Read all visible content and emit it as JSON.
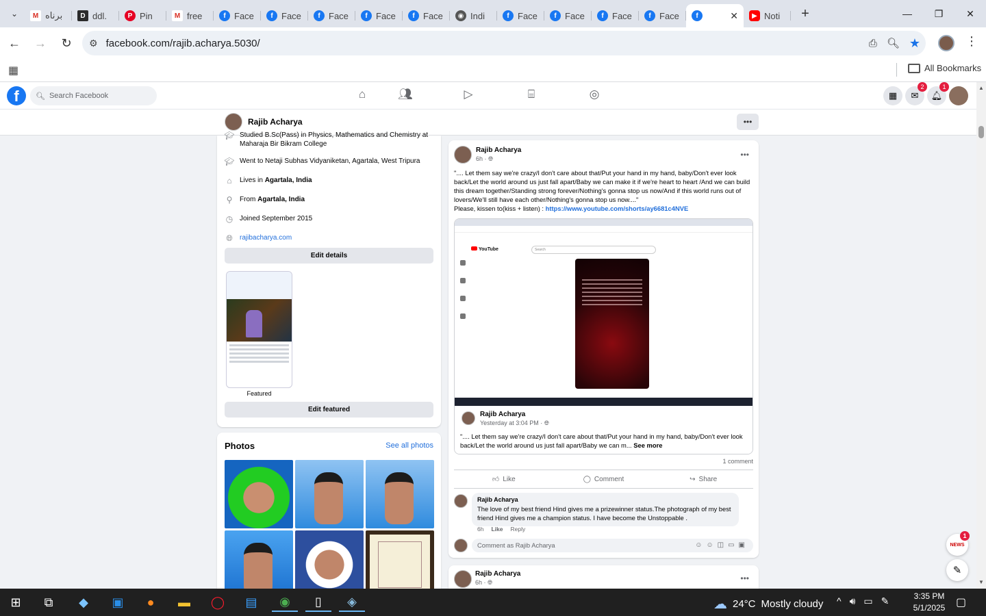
{
  "browser": {
    "tabs": [
      {
        "icon": "gmail-icon",
        "title": "برناه",
        "fav": "gm",
        "letter": "M"
      },
      {
        "icon": "document-icon",
        "title": "ddl.",
        "fav": "dd",
        "letter": "D"
      },
      {
        "icon": "pinterest-icon",
        "title": "Pin",
        "fav": "pin",
        "letter": "P"
      },
      {
        "icon": "gmail-icon",
        "title": "free",
        "fav": "gm",
        "letter": "M"
      },
      {
        "icon": "facebook-icon",
        "title": "Face",
        "fav": "fb",
        "letter": "f"
      },
      {
        "icon": "facebook-icon",
        "title": "Face",
        "fav": "fb",
        "letter": "f"
      },
      {
        "icon": "facebook-icon",
        "title": "Face",
        "fav": "fb",
        "letter": "f"
      },
      {
        "icon": "facebook-icon",
        "title": "Face",
        "fav": "fb",
        "letter": "f"
      },
      {
        "icon": "facebook-icon",
        "title": "Face",
        "fav": "fb",
        "letter": "f"
      },
      {
        "icon": "globe-icon",
        "title": "Indi",
        "fav": "gl",
        "letter": "◉"
      },
      {
        "icon": "facebook-icon",
        "title": "Face",
        "fav": "fb",
        "letter": "f"
      },
      {
        "icon": "facebook-icon",
        "title": "Face",
        "fav": "fb",
        "letter": "f"
      },
      {
        "icon": "facebook-icon",
        "title": "Face",
        "fav": "fb",
        "letter": "f"
      },
      {
        "icon": "facebook-icon",
        "title": "Face",
        "fav": "fb",
        "letter": "f"
      }
    ],
    "active_tab": {
      "icon": "facebook-icon",
      "close": "✕"
    },
    "after_tab": {
      "icon": "youtube-icon",
      "title": "Noti"
    },
    "new_tab": "+",
    "url": "facebook.com/rajib.acharya.5030/",
    "all_bookmarks": "All Bookmarks"
  },
  "facebook": {
    "search_placeholder": "Search Facebook",
    "messenger_badge": "2",
    "notifications_badge": "1"
  },
  "profile": {
    "name": "Rajib Acharya"
  },
  "intro": {
    "studied_prefix": "Studied B.Sc(Pass) in Physics, Mathematics and Chemistry at",
    "studied_school": "Maharaja Bir Bikram College",
    "went_to": "Went to Netaji Subhas Vidyaniketan, Agartala, West Tripura",
    "lives_prefix": "Lives in ",
    "lives_place": "Agartala, India",
    "from_prefix": "From ",
    "from_place": "Agartala, India",
    "joined": "Joined September 2015",
    "website": "rajibacharya.com",
    "edit_details": "Edit details",
    "featured_label": "Featured",
    "edit_featured": "Edit featured"
  },
  "photos": {
    "title": "Photos",
    "see_all": "See all photos"
  },
  "post": {
    "author": "Rajib Acharya",
    "time": "6h · ",
    "text": "\".... Let them say we're crazy/I don't care about that/Put your hand in my hand, baby/Don't ever look back/Let the world around us just fall apart/Baby we can make it if we're heart to heart /And we can build this dream together/Standing strong forever/Nothing's gonna stop us now/And if this world runs out of lovers/We'll still have each other/Nothing's gonna stop us now....\"",
    "listen_prefix": "Please, kissen to(kiss + listen) : ",
    "link": "https://www.youtube.com/shorts/ay6681c4NVE",
    "shared": {
      "author": "Rajib Acharya",
      "time": "Yesterday at 3:04 PM · ",
      "text": "\".... Let them say we're crazy/I don't care about that/Put your hand in my hand, baby/Don't ever look back/Let the world around us just fall apart/Baby we can m...",
      "see_more": " See more",
      "youtube_label": "YouTube",
      "search_label": "Search"
    },
    "comment_count": "1 comment",
    "like": "Like",
    "comment": "Comment",
    "share": "Share",
    "comment_item": {
      "author": "Rajib Acharya",
      "text": "The love of my best friend Hind gives me a prizewinner status.The photograph of my best friend Hind gives me a champion status. I have become the Unstoppable .",
      "time": "6h",
      "like": "Like",
      "reply": "Reply"
    },
    "comment_placeholder": "Comment as Rajib Acharya"
  },
  "next_post": {
    "author": "Rajib Acharya",
    "time": "6h · "
  },
  "floating": {
    "news_badge": "1",
    "news_label": "NEWS"
  },
  "taskbar": {
    "temperature": "24°C",
    "weather": "Mostly cloudy",
    "time": "3:35 PM",
    "date": "5/1/2025"
  }
}
